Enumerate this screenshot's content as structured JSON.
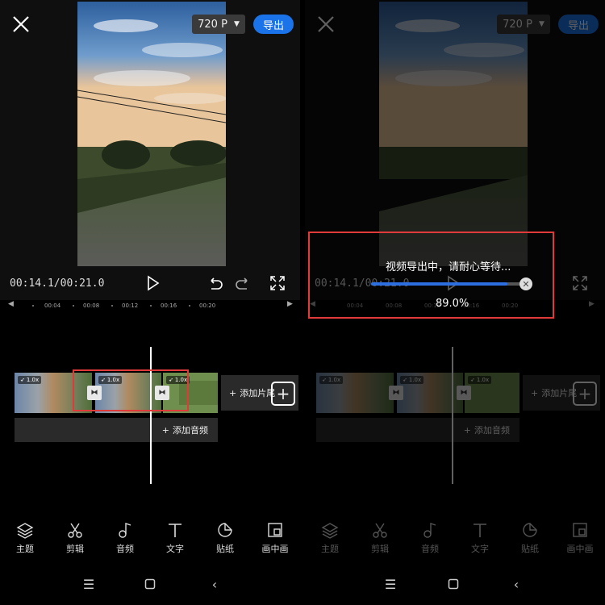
{
  "editor": {
    "quality": "720 P",
    "export_label": "导出",
    "timecode": "00:14.1/00:21.0",
    "ruler": [
      "00:04",
      "00:08",
      "00:12",
      "00:16",
      "00:20"
    ],
    "clips": [
      {
        "speed": "1.0x"
      },
      {
        "speed": "1.0x"
      },
      {
        "speed": "1.0x"
      }
    ],
    "add_tail": "添加片尾",
    "add_audio": "添加音频",
    "tools": [
      {
        "label": "主题",
        "icon": "layers-icon"
      },
      {
        "label": "剪辑",
        "icon": "scissors-icon"
      },
      {
        "label": "音频",
        "icon": "music-note-icon"
      },
      {
        "label": "文字",
        "icon": "text-icon"
      },
      {
        "label": "贴纸",
        "icon": "sticker-icon"
      },
      {
        "label": "画中画",
        "icon": "picture-in-picture-icon"
      }
    ]
  },
  "export_overlay": {
    "message": "视频导出中，请耐心等待...",
    "percent_text": "89.0%",
    "progress": 0.89
  },
  "colors": {
    "accent": "#1a73e8",
    "highlight": "#e03a3a"
  }
}
